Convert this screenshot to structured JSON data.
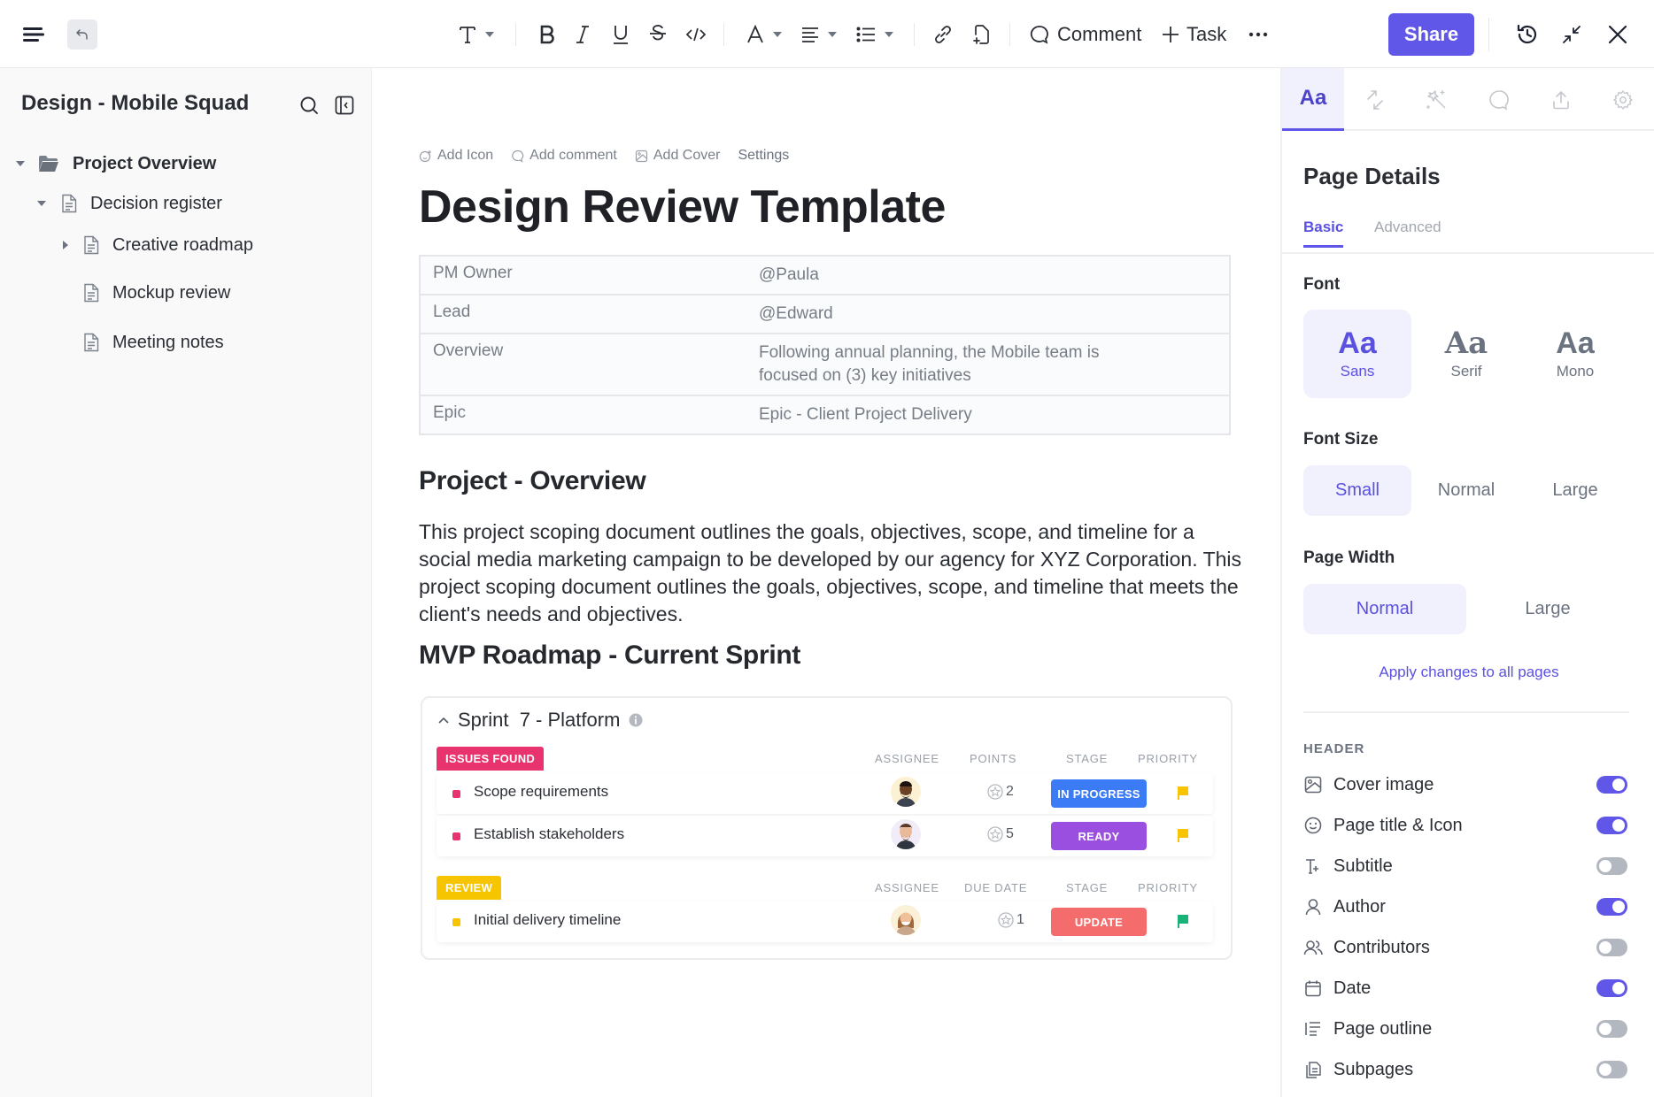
{
  "toolbar": {
    "menu_icon": "hamburger-icon",
    "undo_icon": "undo-icon",
    "text_style_icon": "text-style-icon",
    "formatting": [
      "bold-icon",
      "italic-icon",
      "underline-icon",
      "strikethrough-icon",
      "code-icon"
    ],
    "text_color_icon": "text-color-icon",
    "align_icon": "align-icon",
    "list_icon": "bullet-list-icon",
    "link_icon": "link-icon",
    "embed_icon": "embed-page-icon",
    "comment_label": "Comment",
    "task_label": "Task",
    "more_icon": "more-icon",
    "share_label": "Share",
    "history_icon": "history-icon",
    "collapse_icon": "collapse-icon",
    "close_icon": "close-icon"
  },
  "sidebar": {
    "title": "Design - Mobile Squad",
    "tree": [
      {
        "label": "Project Overview",
        "level": 0,
        "expanded": true,
        "type": "folder"
      },
      {
        "label": "Decision register",
        "level": 1,
        "expanded": true,
        "type": "page"
      },
      {
        "label": "Creative roadmap",
        "level": 2,
        "expanded": false,
        "type": "page"
      },
      {
        "label": "Mockup review",
        "level": 2,
        "type": "page"
      },
      {
        "label": "Meeting notes",
        "level": 2,
        "type": "page"
      }
    ]
  },
  "doc": {
    "actions": {
      "add_icon": "Add Icon",
      "add_comment": "Add comment",
      "add_cover": "Add Cover",
      "settings": "Settings"
    },
    "title": "Design Review Template",
    "properties": [
      {
        "key": "PM Owner",
        "value": "@Paula"
      },
      {
        "key": "Lead",
        "value": "@Edward"
      },
      {
        "key": "Overview",
        "value": "Following annual planning, the Mobile team is focused on (3) key initiatives"
      },
      {
        "key": "Epic",
        "value": "Epic - Client Project Delivery"
      }
    ],
    "section1_heading": "Project - Overview",
    "section1_body": "This project scoping document outlines the goals, objectives, scope, and timeline for a social media marketing campaign to be developed by our agency for XYZ Corporation. This project scoping document outlines the goals, objectives, scope, and timeline that meets the client's needs and objectives.",
    "section2_heading": "MVP Roadmap - Current Sprint"
  },
  "sprint": {
    "title": "Sprint  7 - Platform",
    "groups": [
      {
        "tag": "ISSUES FOUND",
        "color": "#e8336e",
        "columns": [
          "ASSIGNEE",
          "POINTS",
          "STAGE",
          "PRIORITY"
        ],
        "tasks": [
          {
            "name": "Scope requirements",
            "points": "2",
            "stage": "IN PROGRESS",
            "stage_color": "#3b7bf6",
            "priority_color": "#f7c400"
          },
          {
            "name": "Establish stakeholders",
            "points": "5",
            "stage": "READY",
            "stage_color": "#9b4fe0",
            "priority_color": "#f7c400"
          }
        ]
      },
      {
        "tag": "REVIEW",
        "color": "#f7c400",
        "columns": [
          "ASSIGNEE",
          "DUE DATE",
          "STAGE",
          "PRIORITY"
        ],
        "tasks": [
          {
            "name": "Initial delivery timeline",
            "points": "1",
            "stage": "UPDATE",
            "stage_color": "#f56c6c",
            "priority_color": "#19b37a"
          }
        ]
      }
    ]
  },
  "panel": {
    "tabs": [
      "Aa",
      "relations-icon",
      "ai-magic-icon",
      "comments-icon",
      "export-icon",
      "settings-icon"
    ],
    "title": "Page Details",
    "subtabs": {
      "basic": "Basic",
      "advanced": "Advanced"
    },
    "font_label": "Font",
    "fonts": [
      {
        "glyph": "Aa",
        "name": "Sans",
        "selected": true
      },
      {
        "glyph": "Aa",
        "name": "Serif",
        "selected": false
      },
      {
        "glyph": "Aa",
        "name": "Mono",
        "selected": false
      }
    ],
    "font_size_label": "Font Size",
    "font_sizes": [
      {
        "name": "Small",
        "selected": true
      },
      {
        "name": "Normal",
        "selected": false
      },
      {
        "name": "Large",
        "selected": false
      }
    ],
    "page_width_label": "Page Width",
    "page_widths": [
      {
        "name": "Normal",
        "selected": true
      },
      {
        "name": "Large",
        "selected": false
      }
    ],
    "apply_link": "Apply changes to all pages",
    "header_label": "HEADER",
    "header_toggles": [
      {
        "icon": "image-icon",
        "label": "Cover image",
        "on": true
      },
      {
        "icon": "smiley-icon",
        "label": "Page title & Icon",
        "on": true
      },
      {
        "icon": "subtitle-icon",
        "label": "Subtitle",
        "on": false
      },
      {
        "icon": "user-icon",
        "label": "Author",
        "on": true
      },
      {
        "icon": "users-icon",
        "label": "Contributors",
        "on": false
      },
      {
        "icon": "calendar-icon",
        "label": "Date",
        "on": true
      },
      {
        "icon": "outline-icon",
        "label": "Page outline",
        "on": false
      },
      {
        "icon": "subpages-icon",
        "label": "Subpages",
        "on": false
      }
    ]
  },
  "colors": {
    "accent": "#6057e8",
    "accent_bg": "#f1f0fd"
  }
}
